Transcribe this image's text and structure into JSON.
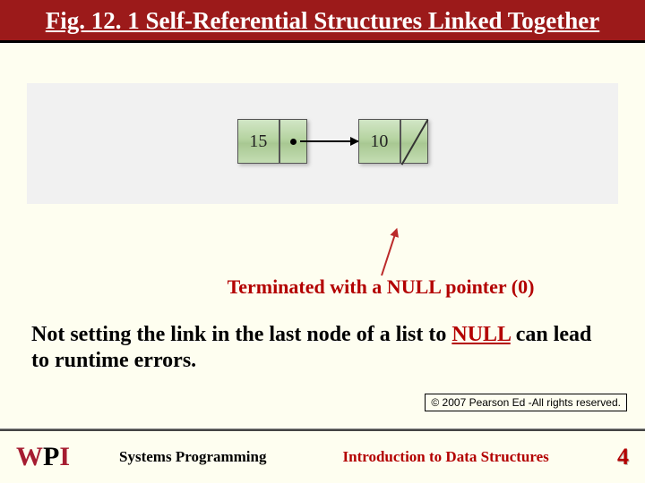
{
  "title": "Fig. 12. 1 Self-Referential Structures Linked Together",
  "nodes": {
    "n1": "15",
    "n2": "10"
  },
  "annotation": "Terminated with a NULL pointer (0)",
  "body": {
    "pre": "Not setting the link in the last node of a list to ",
    "null": "NULL",
    "post": " can lead to runtime errors."
  },
  "copyright": "© 2007 Pearson Ed -All rights reserved.",
  "footer": {
    "left": "Systems Programming",
    "right": "Introduction to Data Structures",
    "page": "4"
  },
  "logo": {
    "w": "W",
    "p": "P",
    "i": "I"
  }
}
